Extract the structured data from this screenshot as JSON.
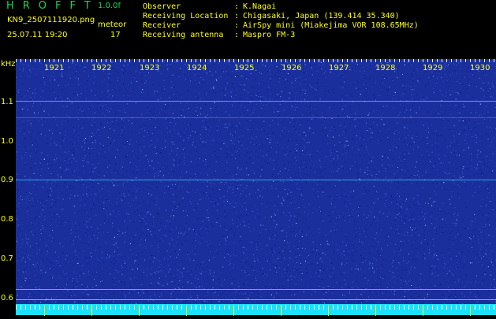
{
  "header": {
    "app_title": "HROFFT",
    "version": "1.0.0f",
    "filename": "KN9_2507111920.png",
    "mode": "meteor",
    "datetime": "25.07.11 19:20",
    "count": "17",
    "meta": [
      {
        "key": "Observer",
        "value": "K.Nagai"
      },
      {
        "key": "Receiving Location",
        "value": "Chigasaki, Japan (139.414 35.340)"
      },
      {
        "key": "Receiver",
        "value": "AirSpy mini (Miakejima VOR 108.65MHz)"
      },
      {
        "key": "Receiving antenna",
        "value": "Maspro FM-3"
      }
    ],
    "separator": ":"
  },
  "axes": {
    "y_unit": "kHz",
    "y_ticks": [
      "1.1",
      "1.0",
      "0.9",
      "0.8",
      "0.7",
      "0.6"
    ],
    "x_ticks": [
      "1921",
      "1922",
      "1923",
      "1924",
      "1925",
      "1926",
      "1927",
      "1928",
      "1929",
      "1930"
    ]
  },
  "colors": {
    "background": "#000000",
    "spectrogram_bg": "#1a2f9c",
    "text_yellow": "#ffff00",
    "title_green": "#19d64a",
    "ruler_cyan": "#18e2ff",
    "signal_line": "#48d8ff"
  }
}
